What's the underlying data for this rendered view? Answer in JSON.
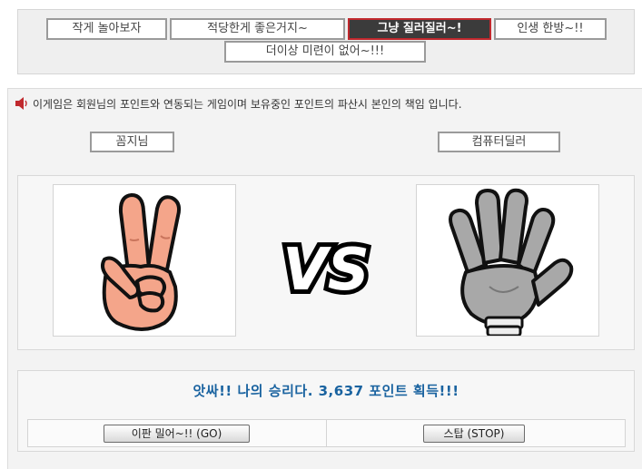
{
  "tabs": [
    {
      "label": "작게 놀아보자",
      "active": false
    },
    {
      "label": "적당한게 좋은거지~",
      "active": false
    },
    {
      "label": "그냥 질러질러~!",
      "active": true
    },
    {
      "label": "인생 한방~!!",
      "active": false
    },
    {
      "label": "더이상 미련이 없어~!!!",
      "active": false
    }
  ],
  "notice": {
    "icon": "speaker-icon",
    "text": "이게임은 회원님의 포인트와 연동되는 게임이며 보유중인 포인트의 파산시 본인의 책임 입니다."
  },
  "players": {
    "left": {
      "label": "꼼지님",
      "hand": "scissors",
      "hand_icon": "scissors-hand-icon",
      "glove_color": "#f4a58a"
    },
    "right": {
      "label": "컴퓨터딜러",
      "hand": "paper",
      "hand_icon": "paper-hand-icon",
      "glove_color": "#a8a8a8"
    }
  },
  "vs_text": "VS",
  "result": {
    "text": "앗싸!! 나의 승리다. 3,637 포인트 획득!!!",
    "color": "#1a63a0"
  },
  "buttons": {
    "go": "이판 밀어~!! (GO)",
    "stop": "스탑 (STOP)"
  },
  "colors": {
    "active_tab_bg": "#3b3b3b",
    "active_tab_border": "#c0282d",
    "result_text": "#1a63a0"
  }
}
